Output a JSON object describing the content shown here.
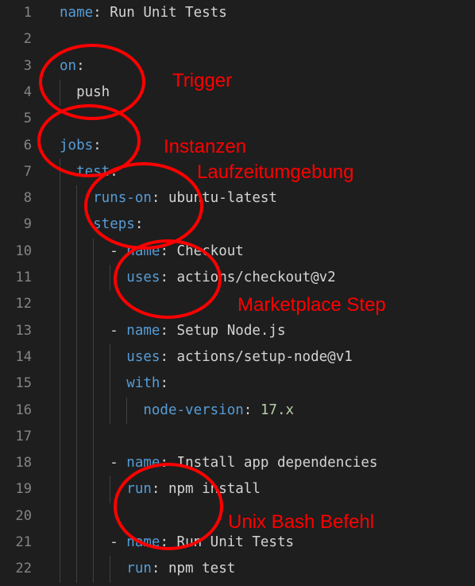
{
  "editor": {
    "lines": [
      {
        "n": "1",
        "segs": [
          {
            "t": "name",
            "c": "key"
          },
          {
            "t": ": ",
            "c": "punc"
          },
          {
            "t": "Run Unit Tests",
            "c": "val"
          }
        ]
      },
      {
        "n": "2",
        "segs": []
      },
      {
        "n": "3",
        "segs": [
          {
            "t": "on",
            "c": "key"
          },
          {
            "t": ":",
            "c": "punc"
          }
        ]
      },
      {
        "n": "4",
        "segs": [
          {
            "t": "  push",
            "c": "val"
          }
        ]
      },
      {
        "n": "5",
        "segs": []
      },
      {
        "n": "6",
        "segs": [
          {
            "t": "jobs",
            "c": "key"
          },
          {
            "t": ":",
            "c": "punc"
          }
        ]
      },
      {
        "n": "7",
        "segs": [
          {
            "t": "  test",
            "c": "key"
          },
          {
            "t": ":",
            "c": "punc"
          }
        ]
      },
      {
        "n": "8",
        "segs": [
          {
            "t": "    runs-on",
            "c": "key"
          },
          {
            "t": ": ",
            "c": "punc"
          },
          {
            "t": "ubuntu-latest",
            "c": "val"
          }
        ]
      },
      {
        "n": "9",
        "segs": [
          {
            "t": "    steps",
            "c": "key"
          },
          {
            "t": ":",
            "c": "punc"
          }
        ]
      },
      {
        "n": "10",
        "segs": [
          {
            "t": "      - ",
            "c": "punc"
          },
          {
            "t": "name",
            "c": "key"
          },
          {
            "t": ": ",
            "c": "punc"
          },
          {
            "t": "Checkout",
            "c": "val"
          }
        ]
      },
      {
        "n": "11",
        "segs": [
          {
            "t": "        uses",
            "c": "key"
          },
          {
            "t": ": ",
            "c": "punc"
          },
          {
            "t": "actions/checkout@v2",
            "c": "val"
          }
        ]
      },
      {
        "n": "12",
        "segs": []
      },
      {
        "n": "13",
        "segs": [
          {
            "t": "      - ",
            "c": "punc"
          },
          {
            "t": "name",
            "c": "key"
          },
          {
            "t": ": ",
            "c": "punc"
          },
          {
            "t": "Setup Node.js",
            "c": "val"
          }
        ]
      },
      {
        "n": "14",
        "segs": [
          {
            "t": "        uses",
            "c": "key"
          },
          {
            "t": ": ",
            "c": "punc"
          },
          {
            "t": "actions/setup-node@v1",
            "c": "val"
          }
        ]
      },
      {
        "n": "15",
        "segs": [
          {
            "t": "        with",
            "c": "key"
          },
          {
            "t": ":",
            "c": "punc"
          }
        ]
      },
      {
        "n": "16",
        "segs": [
          {
            "t": "          node-version",
            "c": "key"
          },
          {
            "t": ": ",
            "c": "punc"
          },
          {
            "t": "17.x",
            "c": "num"
          }
        ]
      },
      {
        "n": "17",
        "segs": []
      },
      {
        "n": "18",
        "segs": [
          {
            "t": "      - ",
            "c": "punc"
          },
          {
            "t": "name",
            "c": "key"
          },
          {
            "t": ": ",
            "c": "punc"
          },
          {
            "t": "Install app dependencies",
            "c": "val"
          }
        ]
      },
      {
        "n": "19",
        "segs": [
          {
            "t": "        run",
            "c": "key"
          },
          {
            "t": ": ",
            "c": "punc"
          },
          {
            "t": "npm install",
            "c": "val"
          }
        ]
      },
      {
        "n": "20",
        "segs": []
      },
      {
        "n": "21",
        "segs": [
          {
            "t": "      - ",
            "c": "punc"
          },
          {
            "t": "name",
            "c": "key"
          },
          {
            "t": ": ",
            "c": "punc"
          },
          {
            "t": "Run Unit Tests",
            "c": "val"
          }
        ]
      },
      {
        "n": "22",
        "segs": [
          {
            "t": "        run",
            "c": "key"
          },
          {
            "t": ": ",
            "c": "punc"
          },
          {
            "t": "npm test",
            "c": "val"
          }
        ]
      }
    ]
  },
  "annotations": {
    "trigger": "Trigger",
    "instanzen": "Instanzen",
    "laufzeitumgebung": "Laufzeitumgebung",
    "marketplace": "Marketplace Step",
    "unix": "Unix Bash Befehl",
    "color": "#ff0000"
  },
  "colors": {
    "background": "#1e1e1e",
    "line_number": "#858585",
    "key": "#569cd6",
    "text": "#d4d4d4",
    "number": "#b5cea8",
    "indent_guide": "#404040"
  }
}
